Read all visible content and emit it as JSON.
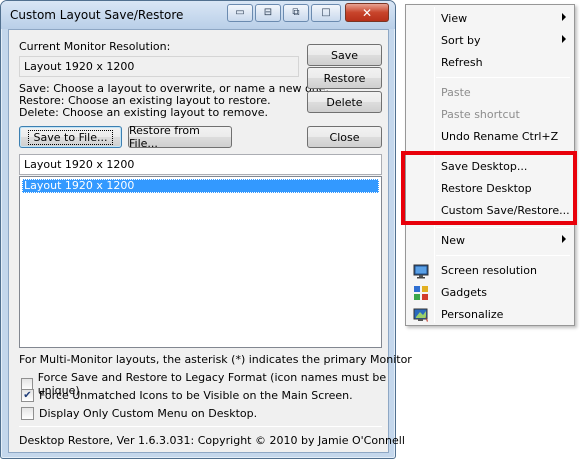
{
  "dialog": {
    "title": "Custom Layout Save/Restore",
    "close_glyph": "✕",
    "current_resolution_label": "Current Monitor Resolution:",
    "current_resolution_value": "Layout 1920 x 1200",
    "help_save": "Save: Choose a layout to overwrite, or name a new one.",
    "help_restore": "Restore: Choose an existing layout to restore.",
    "help_delete": "Delete: Choose an existing layout to remove.",
    "buttons": {
      "save": "Save",
      "restore": "Restore",
      "delete": "Delete",
      "save_to_file": "Save to File...",
      "restore_from_file": "Restore from File...",
      "close": "Close"
    },
    "layout_name_value": "Layout 1920 x 1200",
    "layout_list": [
      "Layout 1920 x 1200"
    ],
    "multi_monitor_note": "For Multi-Monitor layouts, the asterisk (*) indicates the primary Monitor",
    "options": [
      {
        "label": "Force Save and Restore to Legacy Format (icon names must be unique).",
        "checked": false
      },
      {
        "label": "Force Unmatched Icons to be Visible on the Main Screen.",
        "checked": true
      },
      {
        "label": "Display Only Custom Menu on Desktop.",
        "checked": false
      }
    ],
    "footer": "Desktop Restore, Ver 1.6.3.031: Copyright © 2010 by Jamie O'Connell"
  },
  "context_menu": {
    "items": {
      "view": "View",
      "sort_by": "Sort by",
      "refresh": "Refresh",
      "paste": "Paste",
      "paste_shortcut": "Paste shortcut",
      "undo_rename": "Undo Rename    Ctrl+Z",
      "save_desktop": "Save Desktop...",
      "restore_desktop": "Restore Desktop",
      "custom_save_restore": "Custom Save/Restore...",
      "new": "New",
      "screen_resolution": "Screen resolution",
      "gadgets": "Gadgets",
      "personalize": "Personalize"
    },
    "highlight_color": "#e8000a"
  }
}
